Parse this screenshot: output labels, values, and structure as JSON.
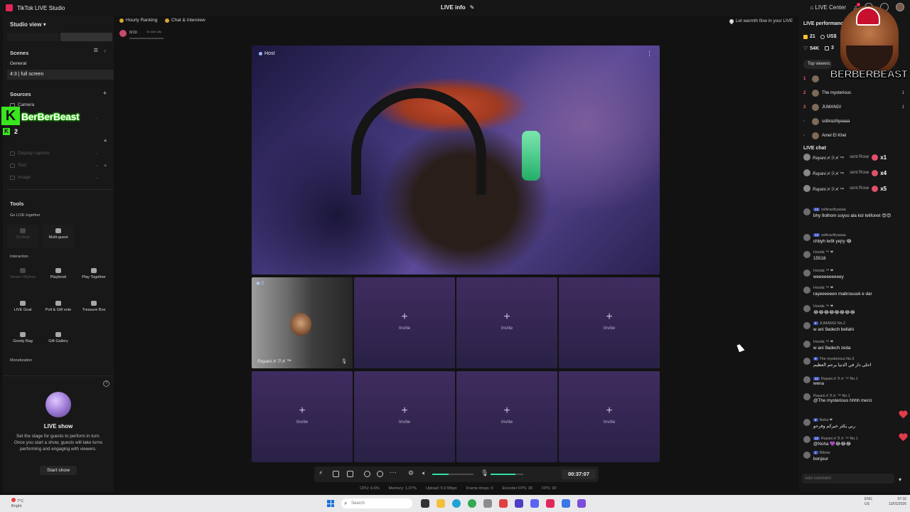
{
  "titlebar": {
    "app_title": "TikTok LIVE Studio",
    "center_title": "LIVE info",
    "live_center": "LIVE Center"
  },
  "left": {
    "studio_view": "Studio view",
    "scenes_title": "Scenes",
    "scenes_group": "General",
    "scene_item": "4:3 | full screen",
    "sources_title": "Sources",
    "sources": [
      {
        "label": "Camera",
        "dim": false
      },
      {
        "label": "Camera",
        "dim": true
      },
      {
        "label": "Display capture",
        "dim": true
      },
      {
        "label": "Text",
        "dim": true
      },
      {
        "label": "Image",
        "dim": true
      }
    ],
    "tools_title": "Tools",
    "go_live_together": "Go LIVE together",
    "interaction": "Interaction",
    "monetization": "Monetization",
    "tools": {
      "cohost": "Co-host",
      "multiguest": "Multi-guest",
      "viewer_wishes": "Viewer Wishes",
      "playbook": "Playbook",
      "play_together": "Play Together",
      "live_goal": "LIVE Goal",
      "poll_gift_vote": "Poll & Gift vote",
      "treasure_box": "Treasure Box",
      "goody_bag": "Goody Bag",
      "gift_gallery": "Gift Gallery"
    },
    "live_show_title": "LIVE show",
    "live_show_desc": "Set the stage for guests to perform in turn. Once you start a show, guests will take turns performing and engaging with viewers.",
    "start_show": "Start show"
  },
  "brand": {
    "name": "BerBerBeast",
    "k_letter": "K",
    "sub_num": "2"
  },
  "top_chips": {
    "hourly_ranking": "Hourly Ranking",
    "chat_interview": "Chat & Interview",
    "mini_count": "0/10",
    "mini_time": "1h 44m 18s",
    "warmth": "Let warmth flow in your LIVE"
  },
  "stage": {
    "host_label": "Host",
    "guest_number": "2",
    "guest_name": "Rayaniメラメ ™",
    "invite": "Invite",
    "invite_tiles": 7,
    "timer": "00:37:07",
    "mic_level": 0.75,
    "speaker_level": 0.4
  },
  "stats": {
    "cpu": "CPU: 4.6%",
    "memory": "Memory: 1.07%",
    "upload": "Upload: 5.0 Mbps",
    "frame_drops": "Frame drops: 0",
    "encoder_fps": "Encoder FPS: 30",
    "fps": "FPS: 30"
  },
  "right": {
    "header": "LIVE performance",
    "stats": {
      "diamonds": "21",
      "usd": "US$",
      "likes": "54K",
      "viewers": "3"
    },
    "top_viewers": "Top viewers",
    "ranking": [
      {
        "n": "1",
        "name": "",
        "score": ""
      },
      {
        "n": "2",
        "name": "The mysterious",
        "score": "1"
      },
      {
        "n": "3",
        "name": "JUMANGI",
        "score": "1"
      },
      {
        "n": "-",
        "name": "sslbraziliyaaaa",
        "score": ""
      },
      {
        "n": "-",
        "name": "Amel El Khel",
        "score": ""
      }
    ],
    "live_chat": "LIVE chat",
    "gifts": [
      {
        "name": "Rayaniメラメ ™",
        "text": "sent Rose",
        "mult": "x1"
      },
      {
        "name": "Rayaniメラメ ™",
        "text": "sent Rose",
        "mult": "x4"
      },
      {
        "name": "Rayaniメラメ ™",
        "text": "sent Rose",
        "mult": "x5"
      }
    ],
    "chat": [
      {
        "name": "sslbraziliyaaaa",
        "badge": "13",
        "text": "bhy 9olhom soyso ala kol telifonet 😍😍"
      },
      {
        "name": "sslbraziliyaaaa",
        "badge": "13",
        "text": "chbyh lw9t yejry 😂"
      },
      {
        "name": "Hooda ™ ❤",
        "badge": "",
        "text": "15518"
      },
      {
        "name": "Hooda ™ ❤",
        "badge": "",
        "text": "weeeeeeeeeey"
      },
      {
        "name": "Hooda ™ ❤",
        "badge": "",
        "text": "rayeeeeeen mabrouuuk e dar"
      },
      {
        "name": "Hooda ™ ❤",
        "badge": "",
        "text": "😂😂😂😂😂😂😂😂"
      },
      {
        "name": "JUMANGI No.2",
        "badge": "6",
        "text": "w ani 9adech bellahi"
      },
      {
        "name": "Hooda ™ ❤",
        "badge": "",
        "text": "w ani 9adech zeda"
      },
      {
        "name": "The mysterious No.3",
        "badge": "9",
        "text": "احلى دار في الدنيا يرحم العظيم"
      },
      {
        "name": "Rayaniメラメ ™ No.1",
        "badge": "32",
        "text": "wena"
      },
      {
        "name": "Rayaniメラメ ™ No.1",
        "badge": "",
        "text": "@The mysterious hhhh merci"
      },
      {
        "name": "Noha ❤",
        "badge": "8",
        "text": "ربي يكثر خيركم وفرحو"
      },
      {
        "name": "Rayaniメラメ ™ No.1",
        "badge": "32",
        "text": "@Noha 💜😂😂😂"
      },
      {
        "name": "Nibras",
        "badge": "2",
        "text": "bonjour"
      }
    ],
    "add_comment": "Add comment"
  },
  "logo": {
    "text": "BERBERBEAST"
  },
  "taskbar": {
    "search": "Search",
    "weather_temp": "7°C",
    "weather_desc": "Bright",
    "lang": "ENG",
    "region": "US",
    "time": "07:16",
    "date": "13/01/2026"
  }
}
